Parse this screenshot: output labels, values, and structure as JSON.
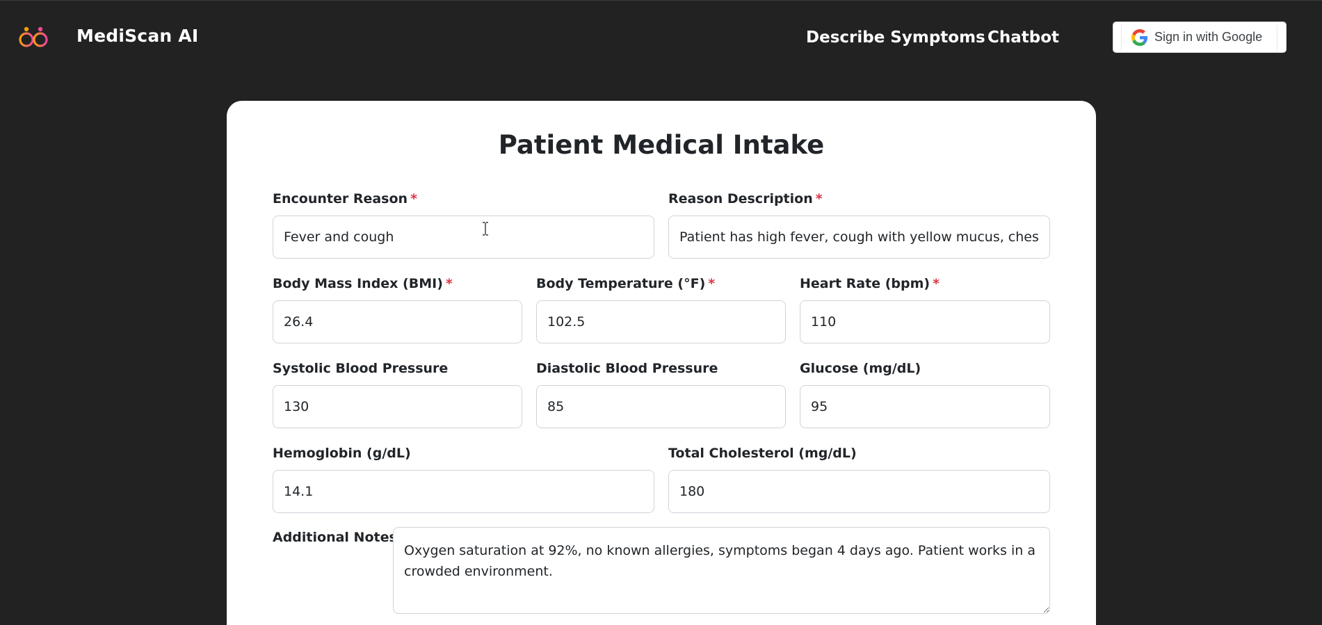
{
  "nav": {
    "brand": "MediScan AI",
    "links": [
      "Describe Symptoms",
      "Chatbot"
    ],
    "sign_in_label": "Sign in with Google"
  },
  "form": {
    "title": "Patient Medical Intake",
    "fields": {
      "encounter_reason": {
        "label": "Encounter Reason",
        "required": "*",
        "value": "Fever and cough"
      },
      "reason_description": {
        "label": "Reason Description",
        "required": "*",
        "value": "Patient has high fever, cough with yellow mucus, chest pain"
      },
      "bmi": {
        "label": "Body Mass Index (BMI)",
        "required": "*",
        "value": "26.4"
      },
      "body_temperature": {
        "label": "Body Temperature (°F)",
        "required": "*",
        "value": "102.5"
      },
      "heart_rate": {
        "label": "Heart Rate (bpm)",
        "required": "*",
        "value": "110"
      },
      "systolic_bp": {
        "label": "Systolic Blood Pressure",
        "value": "130"
      },
      "diastolic_bp": {
        "label": "Diastolic Blood Pressure",
        "value": "85"
      },
      "glucose": {
        "label": "Glucose (mg/dL)",
        "value": "95"
      },
      "hemoglobin": {
        "label": "Hemoglobin (g/dL)",
        "value": "14.1"
      },
      "cholesterol": {
        "label": "Total Cholesterol (mg/dL)",
        "value": "180"
      },
      "notes": {
        "label": "Additional Notes",
        "value": "Oxygen saturation at 92%, no known allergies, symptoms began 4 days ago. Patient works in a crowded environment."
      }
    }
  },
  "colors": {
    "background": "#222222",
    "card": "#ffffff",
    "required_marker": "#dc3545",
    "logo_gradient": [
      "#f59e0b",
      "#ec4899"
    ]
  },
  "icons": [
    "mediscan-logo-icon",
    "google-g-icon",
    "text-cursor-icon"
  ]
}
